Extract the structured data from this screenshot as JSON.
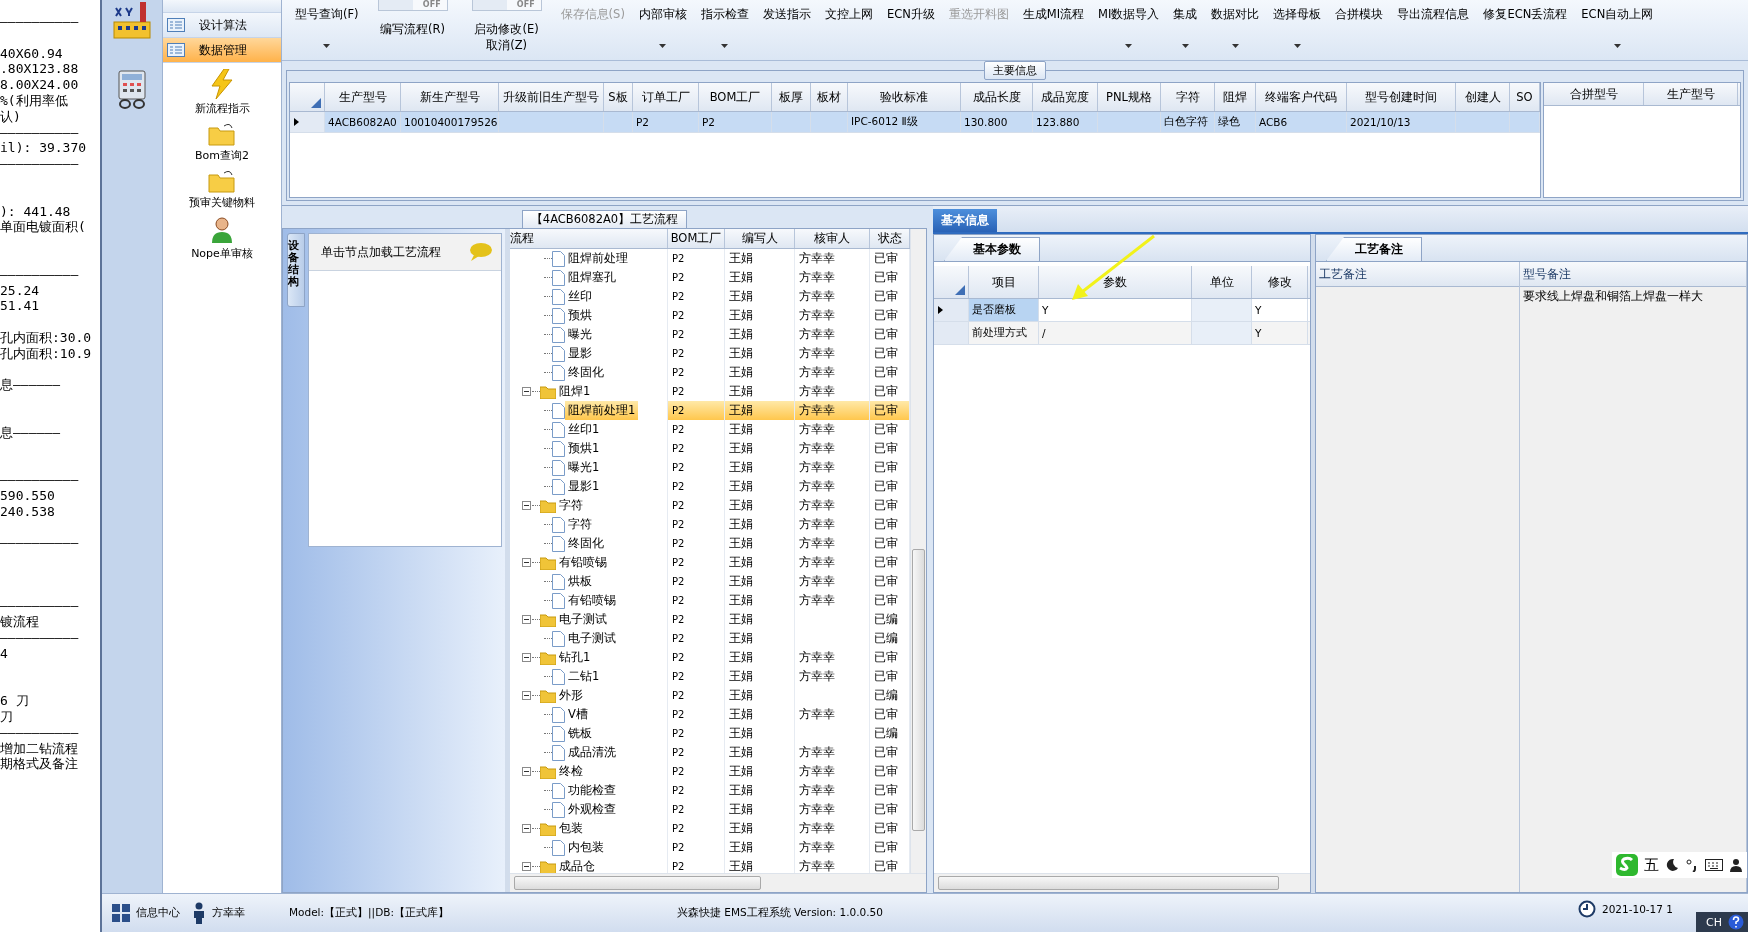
{
  "background_window": {
    "lines": [
      {
        "kind": "text",
        "text": "——————————"
      },
      {
        "kind": "blank"
      },
      {
        "kind": "text",
        "text": "40X60.94"
      },
      {
        "kind": "text",
        "text": ".80X123.88"
      },
      {
        "kind": "text",
        "text": "8.00X24.00"
      },
      {
        "kind": "text",
        "text": "%(利用率低"
      },
      {
        "kind": "text",
        "text": "认)"
      },
      {
        "kind": "text",
        "text": "——————————"
      },
      {
        "kind": "text",
        "text": "il): 39.370"
      },
      {
        "kind": "text",
        "text": "——————————"
      },
      {
        "kind": "blank"
      },
      {
        "kind": "blank"
      },
      {
        "kind": "text",
        "text": "): 441.48"
      },
      {
        "kind": "text",
        "text": "单面电镀面积("
      },
      {
        "kind": "blank"
      },
      {
        "kind": "blank"
      },
      {
        "kind": "text",
        "text": "——————————"
      },
      {
        "kind": "text",
        "text": "25.24"
      },
      {
        "kind": "text",
        "text": "51.41"
      },
      {
        "kind": "blank"
      },
      {
        "kind": "text",
        "text": "孔内面积:30.0"
      },
      {
        "kind": "text",
        "text": "孔内面积:10.9"
      },
      {
        "kind": "blank"
      },
      {
        "kind": "text",
        "text": "息——————"
      },
      {
        "kind": "blank"
      },
      {
        "kind": "blank"
      },
      {
        "kind": "text",
        "text": "息——————"
      },
      {
        "kind": "blank"
      },
      {
        "kind": "blank"
      },
      {
        "kind": "text",
        "text": "——————————"
      },
      {
        "kind": "text",
        "text": " 590.550"
      },
      {
        "kind": "text",
        "text": " 240.538"
      },
      {
        "kind": "blank"
      },
      {
        "kind": "text",
        "text": "——————————"
      },
      {
        "kind": "blank"
      },
      {
        "kind": "blank"
      },
      {
        "kind": "blank"
      },
      {
        "kind": "text",
        "text": "——————————"
      },
      {
        "kind": "text",
        "text": "镀流程"
      },
      {
        "kind": "text",
        "text": "——————————"
      },
      {
        "kind": "text",
        "text": "4"
      },
      {
        "kind": "blank"
      },
      {
        "kind": "blank"
      },
      {
        "kind": "text",
        "text": "6 刀"
      },
      {
        "kind": "text",
        "text": "刀"
      },
      {
        "kind": "text",
        "text": "——————————"
      },
      {
        "kind": "text",
        "text": "增加二钻流程"
      },
      {
        "kind": "text",
        "text": "期格式及备注"
      }
    ]
  },
  "nav": {
    "items": [
      {
        "label": "设计算法",
        "selected": false
      },
      {
        "label": "数据管理",
        "selected": true
      }
    ],
    "tools": [
      {
        "label": "新流程指示",
        "kind": "bolt"
      },
      {
        "label": "Bom查询2",
        "kind": "folder"
      },
      {
        "label": "预审关键物料",
        "kind": "folder"
      },
      {
        "label": "Nope单审核",
        "kind": "user"
      }
    ]
  },
  "toolbar": [
    {
      "kind": "button",
      "label": "型号查询(F)",
      "dropdown": true,
      "disabled": false
    },
    {
      "kind": "toggle",
      "switch": "OFF",
      "on": false,
      "labels": [
        "编写流程(R)"
      ]
    },
    {
      "kind": "toggle",
      "switch": "OFF",
      "on": false,
      "labels": [
        "启动修改(E)",
        "取消(Z)"
      ]
    },
    {
      "kind": "button",
      "label": "保存信息(S)",
      "dropdown": false,
      "disabled": true
    },
    {
      "kind": "button",
      "label": "内部审核",
      "dropdown": true,
      "disabled": false
    },
    {
      "kind": "button",
      "label": "指示检查",
      "dropdown": true,
      "disabled": false
    },
    {
      "kind": "button",
      "label": "发送指示",
      "dropdown": false,
      "disabled": false
    },
    {
      "kind": "button",
      "label": "文控上网",
      "dropdown": false,
      "disabled": false
    },
    {
      "kind": "button",
      "label": "ECN升级",
      "dropdown": false,
      "disabled": false
    },
    {
      "kind": "button",
      "label": "重选开料图",
      "dropdown": false,
      "disabled": true
    },
    {
      "kind": "button",
      "label": "生成MI流程",
      "dropdown": false,
      "disabled": false
    },
    {
      "kind": "button",
      "label": "MI数据导入",
      "dropdown": true,
      "disabled": false
    },
    {
      "kind": "button",
      "label": "集成",
      "dropdown": true,
      "disabled": false
    },
    {
      "kind": "button",
      "label": "数据对比",
      "dropdown": true,
      "disabled": false
    },
    {
      "kind": "button",
      "label": "选择母板",
      "dropdown": true,
      "disabled": false
    },
    {
      "kind": "button",
      "label": "合拼模块",
      "dropdown": false,
      "disabled": false
    },
    {
      "kind": "button",
      "label": "导出流程信息",
      "dropdown": false,
      "disabled": false
    },
    {
      "kind": "button",
      "label": "修复ECN丢流程",
      "dropdown": false,
      "disabled": false
    },
    {
      "kind": "button",
      "label": "ECN自动上网",
      "dropdown": true,
      "disabled": false
    }
  ],
  "main_info": {
    "title": "主要信息",
    "columns": [
      "生产型号",
      "新生产型号",
      "升级前旧生产型号",
      "S板",
      "订单工厂",
      "BOM工厂",
      "板厚",
      "板材",
      "验收标准",
      "成品长度",
      "成品宽度",
      "PNL规格",
      "字符",
      "阻焊",
      "终端客户代码",
      "型号创建时间",
      "创建人",
      "SO"
    ],
    "rows": [
      {
        "selected": true,
        "cells": [
          "4ACB6082A0",
          "10010400179526",
          null,
          null,
          "P2",
          "P2",
          null,
          null,
          "IPC-6012 Ⅱ级",
          "130.800",
          "123.880",
          null,
          "白色字符",
          "绿色",
          "ACB6",
          "2021/10/13",
          null,
          null
        ]
      }
    ],
    "side_columns": [
      "合拼型号",
      "生产型号"
    ]
  },
  "process": {
    "title": "【4ACB6082A0】工艺流程",
    "side_tab": "设备结构",
    "hint": "单击节点加载工艺流程",
    "columns": [
      "流程",
      "BOM工厂",
      "编写人",
      "核审人",
      "状态"
    ],
    "tree": [
      {
        "kind": "hidden",
        "children": [
          {
            "kind": "leaf",
            "label": "阻焊前处理",
            "bom": "P2",
            "writer": "王娟",
            "reviewer": "方幸幸",
            "status": "已审",
            "selected": false
          },
          {
            "kind": "leaf",
            "label": "阻焊塞孔",
            "bom": "P2",
            "writer": "王娟",
            "reviewer": "方幸幸",
            "status": "已审",
            "selected": false
          },
          {
            "kind": "leaf",
            "label": "丝印",
            "bom": "P2",
            "writer": "王娟",
            "reviewer": "方幸幸",
            "status": "已审",
            "selected": false
          },
          {
            "kind": "leaf",
            "label": "预烘",
            "bom": "P2",
            "writer": "王娟",
            "reviewer": "方幸幸",
            "status": "已审",
            "selected": false
          },
          {
            "kind": "leaf",
            "label": "曝光",
            "bom": "P2",
            "writer": "王娟",
            "reviewer": "方幸幸",
            "status": "已审",
            "selected": false
          },
          {
            "kind": "leaf",
            "label": "显影",
            "bom": "P2",
            "writer": "王娟",
            "reviewer": "方幸幸",
            "status": "已审",
            "selected": false
          },
          {
            "kind": "leaf",
            "label": "终固化",
            "bom": "P2",
            "writer": "王娟",
            "reviewer": "方幸幸",
            "status": "已审",
            "selected": false
          }
        ]
      },
      {
        "kind": "folder",
        "label": "阻焊1",
        "bom": "P2",
        "writer": "王娟",
        "reviewer": "方幸幸",
        "status": "已审",
        "selected": false,
        "expanded": true,
        "children": [
          {
            "kind": "leaf",
            "label": "阻焊前处理1",
            "bom": "P2",
            "writer": "王娟",
            "reviewer": "方幸幸",
            "status": "已审",
            "selected": true
          },
          {
            "kind": "leaf",
            "label": "丝印1",
            "bom": "P2",
            "writer": "王娟",
            "reviewer": "方幸幸",
            "status": "已审",
            "selected": false
          },
          {
            "kind": "leaf",
            "label": "预烘1",
            "bom": "P2",
            "writer": "王娟",
            "reviewer": "方幸幸",
            "status": "已审",
            "selected": false
          },
          {
            "kind": "leaf",
            "label": "曝光1",
            "bom": "P2",
            "writer": "王娟",
            "reviewer": "方幸幸",
            "status": "已审",
            "selected": false
          },
          {
            "kind": "leaf",
            "label": "显影1",
            "bom": "P2",
            "writer": "王娟",
            "reviewer": "方幸幸",
            "status": "已审",
            "selected": false
          }
        ]
      },
      {
        "kind": "folder",
        "label": "字符",
        "bom": "P2",
        "writer": "王娟",
        "reviewer": "方幸幸",
        "status": "已审",
        "selected": false,
        "expanded": true,
        "children": [
          {
            "kind": "leaf",
            "label": "字符",
            "bom": "P2",
            "writer": "王娟",
            "reviewer": "方幸幸",
            "status": "已审",
            "selected": false
          },
          {
            "kind": "leaf",
            "label": "终固化",
            "bom": "P2",
            "writer": "王娟",
            "reviewer": "方幸幸",
            "status": "已审",
            "selected": false
          }
        ]
      },
      {
        "kind": "folder",
        "label": "有铅喷锡",
        "bom": "P2",
        "writer": "王娟",
        "reviewer": "方幸幸",
        "status": "已审",
        "selected": false,
        "expanded": true,
        "children": [
          {
            "kind": "leaf",
            "label": "烘板",
            "bom": "P2",
            "writer": "王娟",
            "reviewer": "方幸幸",
            "status": "已审",
            "selected": false
          },
          {
            "kind": "leaf",
            "label": "有铅喷锡",
            "bom": "P2",
            "writer": "王娟",
            "reviewer": "方幸幸",
            "status": "已审",
            "selected": false
          }
        ]
      },
      {
        "kind": "folder",
        "label": "电子测试",
        "bom": "P2",
        "writer": "王娟",
        "status": "已编",
        "selected": false,
        "expanded": true,
        "children": [
          {
            "kind": "leaf",
            "label": "电子测试",
            "bom": "P2",
            "writer": "王娟",
            "status": "已编",
            "selected": false
          }
        ]
      },
      {
        "kind": "folder",
        "label": "钻孔1",
        "bom": "P2",
        "writer": "王娟",
        "reviewer": "方幸幸",
        "status": "已审",
        "selected": false,
        "expanded": true,
        "children": [
          {
            "kind": "leaf",
            "label": "二钻1",
            "bom": "P2",
            "writer": "王娟",
            "reviewer": "方幸幸",
            "status": "已审",
            "selected": false
          }
        ]
      },
      {
        "kind": "folder",
        "label": "外形",
        "bom": "P2",
        "writer": "王娟",
        "status": "已编",
        "selected": false,
        "expanded": true,
        "children": [
          {
            "kind": "leaf",
            "label": "V槽",
            "bom": "P2",
            "writer": "王娟",
            "reviewer": "方幸幸",
            "status": "已审",
            "selected": false
          },
          {
            "kind": "leaf",
            "label": "铣板",
            "bom": "P2",
            "writer": "王娟",
            "status": "已编",
            "selected": false
          },
          {
            "kind": "leaf",
            "label": "成品清洗",
            "bom": "P2",
            "writer": "王娟",
            "reviewer": "方幸幸",
            "status": "已审",
            "selected": false
          }
        ]
      },
      {
        "kind": "folder",
        "label": "终检",
        "bom": "P2",
        "writer": "王娟",
        "reviewer": "方幸幸",
        "status": "已审",
        "selected": false,
        "expanded": true,
        "children": [
          {
            "kind": "leaf",
            "label": "功能检查",
            "bom": "P2",
            "writer": "王娟",
            "reviewer": "方幸幸",
            "status": "已审",
            "selected": false
          },
          {
            "kind": "leaf",
            "label": "外观检查",
            "bom": "P2",
            "writer": "王娟",
            "reviewer": "方幸幸",
            "status": "已审",
            "selected": false
          }
        ]
      },
      {
        "kind": "folder",
        "label": "包装",
        "bom": "P2",
        "writer": "王娟",
        "reviewer": "方幸幸",
        "status": "已审",
        "selected": false,
        "expanded": true,
        "children": [
          {
            "kind": "leaf",
            "label": "内包装",
            "bom": "P2",
            "writer": "王娟",
            "reviewer": "方幸幸",
            "status": "已审",
            "selected": false
          }
        ]
      },
      {
        "kind": "folder",
        "label": "成品仓",
        "bom": "P2",
        "writer": "王娟",
        "reviewer": "方幸幸",
        "status": "已审",
        "selected": false,
        "expanded": true
      }
    ]
  },
  "basic_info": {
    "tab": "基本信息",
    "params": {
      "tab": "基本参数",
      "columns": [
        "项目",
        "参数",
        "单位",
        "修改"
      ],
      "rows": [
        {
          "current": true,
          "cells": [
            "是否磨板",
            "Y",
            null,
            "Y"
          ]
        },
        {
          "current": false,
          "cells": [
            "前处理方式",
            "/",
            null,
            "Y"
          ]
        }
      ]
    },
    "notes": {
      "tab": "工艺备注",
      "columns": [
        "工艺备注",
        "型号备注"
      ],
      "model_note": "要求线上焊盘和铜箔上焊盘一样大"
    }
  },
  "status_bar": {
    "info_center": "信息中心",
    "user": "方幸幸",
    "model": "Model:【正式】||DB:【正式库】",
    "system": "兴森快捷 EMS工程系统 Version: 1.0.0.50",
    "datetime": "2021-10-17 1"
  },
  "ime_toolbar": {
    "mode": "五"
  },
  "taskbar": {
    "language": "CH"
  }
}
